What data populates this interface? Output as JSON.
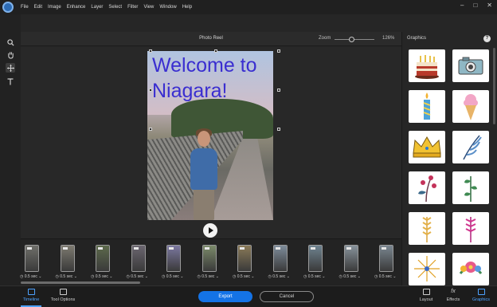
{
  "menu": {
    "items": [
      "File",
      "Edit",
      "Image",
      "Enhance",
      "Layer",
      "Select",
      "Filter",
      "View",
      "Window",
      "Help"
    ]
  },
  "window_controls": [
    "–",
    "□",
    "✕"
  ],
  "tools": [
    "search-icon",
    "hand-icon",
    "move-icon",
    "text-icon"
  ],
  "canvas": {
    "title": "Photo Reel",
    "zoom_label": "Zoom",
    "zoom_value": "126%",
    "zoom_level_fraction": 0.42
  },
  "photo": {
    "title_line1": "Welcome to",
    "title_line2": "Niagara!",
    "title_color": "#3a2ed0"
  },
  "timeline": {
    "frames": [
      {
        "duration": "0.5 sec",
        "color": "#6f6f6a"
      },
      {
        "duration": "0.5 sec",
        "color": "#7d7a70"
      },
      {
        "duration": "0.5 sec",
        "color": "#5d6a4c"
      },
      {
        "duration": "0.5 sec",
        "color": "#6b6670"
      },
      {
        "duration": "0.5 sec",
        "color": "#7c78a0"
      },
      {
        "duration": "0.5 sec",
        "color": "#7b8a6a"
      },
      {
        "duration": "0.5 sec",
        "color": "#8a7a58"
      },
      {
        "duration": "0.5 sec",
        "color": "#7e8c9a"
      },
      {
        "duration": "0.5 sec",
        "color": "#6f8390"
      },
      {
        "duration": "0.5 sec",
        "color": "#88939c"
      },
      {
        "duration": "0.5 sec",
        "color": "#7a8690"
      }
    ]
  },
  "panel": {
    "title": "Graphics",
    "help": "?",
    "items": [
      "birthday-cake-icon",
      "camera-icon",
      "candle-icon",
      "ice-cream-icon",
      "crown-icon",
      "feather-leaves-icon",
      "berry-branch-icon",
      "green-leaves-icon",
      "wheat-icon",
      "magenta-leaf-icon",
      "firework-icon",
      "flower-bouquet-icon"
    ]
  },
  "bottom": {
    "timeline": "Timeline",
    "tool_options": "Tool Options",
    "export": "Export",
    "cancel": "Cancel",
    "layout": "Layout",
    "effects": "Effects",
    "graphics": "Graphics"
  },
  "colors": {
    "accent": "#1473e6",
    "active_tab": "#4ea2ff"
  }
}
